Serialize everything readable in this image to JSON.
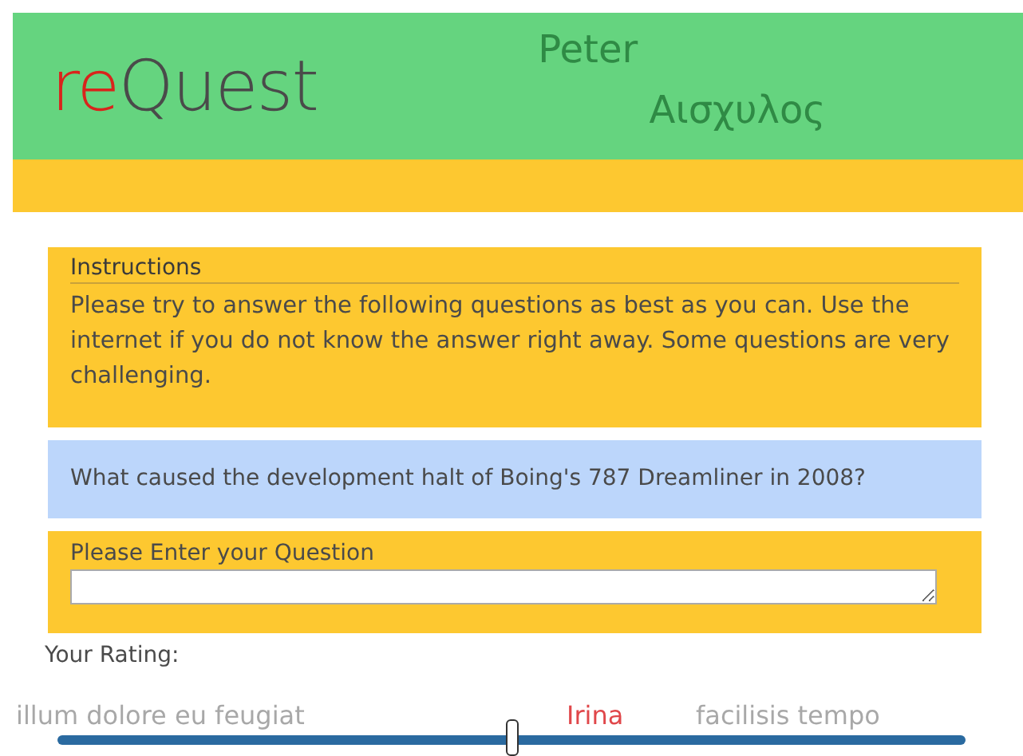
{
  "logo": {
    "prefix": "re",
    "rest": "Quest"
  },
  "header_words": [
    {
      "text": "Peter",
      "accent": false
    },
    {
      "text": "Αισχυλος",
      "accent": false
    }
  ],
  "page_words": [
    {
      "text": "illum dolore eu feugiat",
      "accent": false
    },
    {
      "text": "Irina",
      "accent": true
    },
    {
      "text": "facilisis tempo",
      "accent": false
    }
  ],
  "instructions": {
    "title": "Instructions",
    "text": "Please try to answer the following questions as best as you can. Use the internet if you do not know the answer right away. Some questions are very challenging."
  },
  "question": "What caused the development halt of Boing's 787 Dreamliner in 2008?",
  "entry": {
    "label": "Please Enter your Question"
  },
  "rating": {
    "label": "Your Rating:",
    "level": 0.5
  }
}
